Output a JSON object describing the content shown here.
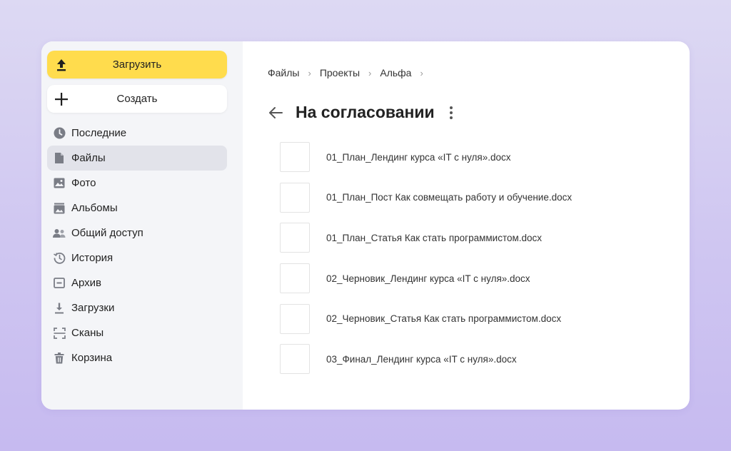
{
  "sidebar": {
    "upload_label": "Загрузить",
    "create_label": "Создать",
    "items": [
      {
        "label": "Последние",
        "icon": "clock-icon",
        "active": false
      },
      {
        "label": "Файлы",
        "icon": "file-icon",
        "active": true
      },
      {
        "label": "Фото",
        "icon": "photo-icon",
        "active": false
      },
      {
        "label": "Альбомы",
        "icon": "albums-icon",
        "active": false
      },
      {
        "label": "Общий доступ",
        "icon": "shared-icon",
        "active": false
      },
      {
        "label": "История",
        "icon": "history-icon",
        "active": false
      },
      {
        "label": "Архив",
        "icon": "archive-icon",
        "active": false
      },
      {
        "label": "Загрузки",
        "icon": "download-icon",
        "active": false
      },
      {
        "label": "Сканы",
        "icon": "scan-icon",
        "active": false
      },
      {
        "label": "Корзина",
        "icon": "trash-icon",
        "active": false
      }
    ]
  },
  "breadcrumb": [
    "Файлы",
    "Проекты",
    "Альфа"
  ],
  "page": {
    "title": "На согласовании"
  },
  "files": [
    {
      "name": "01_План_Лендинг курса «IT с нуля».docx"
    },
    {
      "name": "01_План_Пост Как совмещать работу и обучение.docx"
    },
    {
      "name": "01_План_Статья Как стать программистом.docx"
    },
    {
      "name": "02_Черновик_Лендинг курса «IT с нуля».docx"
    },
    {
      "name": "02_Черновик_Статья Как стать программистом.docx"
    },
    {
      "name": "03_Финал_Лендинг курса «IT с нуля».docx"
    }
  ],
  "colors": {
    "accent_yellow": "#ffdc4d",
    "sidebar_bg": "#f4f5f8",
    "active_item_bg": "#e2e3ea",
    "icon_gray": "#7a7d86"
  }
}
